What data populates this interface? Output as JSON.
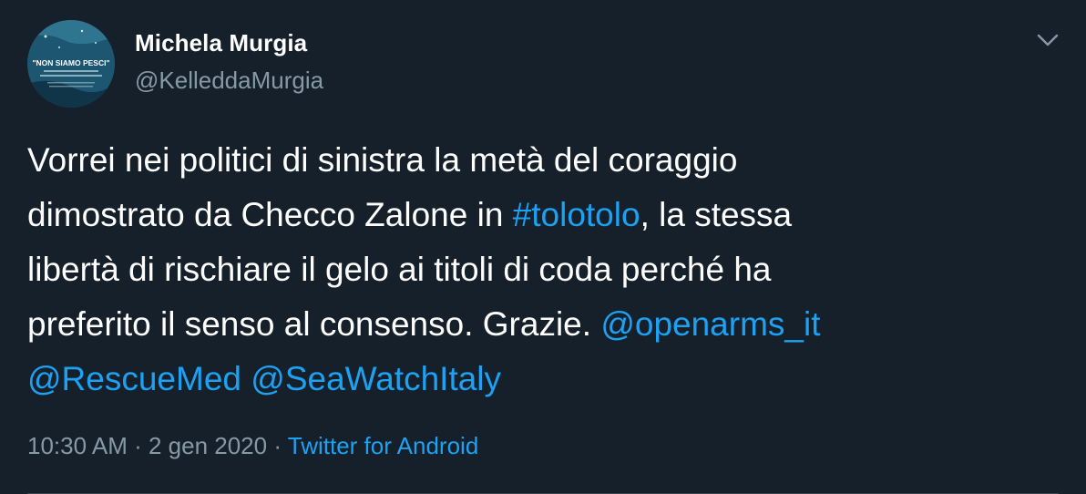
{
  "author": {
    "name": "Michela Murgia",
    "handle": "@KelleddaMurgia",
    "avatar_text": "\"NON SIAMO PESCI\""
  },
  "tweet": {
    "line1": "Vorrei nei politici di sinistra la metà del coraggio",
    "line2_pre": "dimostrato da Checco Zalone in ",
    "hashtag": "#tolotolo",
    "line2_post": ", la stessa",
    "line3": "libertà di rischiare il gelo ai titoli di coda perché ha",
    "line4_pre": "preferito il senso al consenso. Grazie. ",
    "mention1": "@openarms_it",
    "mention2": "@RescueMed",
    "mention3": "@SeaWatchItaly"
  },
  "meta": {
    "time": "10:30 AM",
    "sep1": " · ",
    "date": "2 gen 2020",
    "sep2": " · ",
    "source": "Twitter for Android"
  },
  "colors": {
    "background": "#15202b",
    "link": "#1da1f2",
    "secondary_text": "#8899a6"
  },
  "icons": {
    "caret": "chevron-down-icon"
  }
}
